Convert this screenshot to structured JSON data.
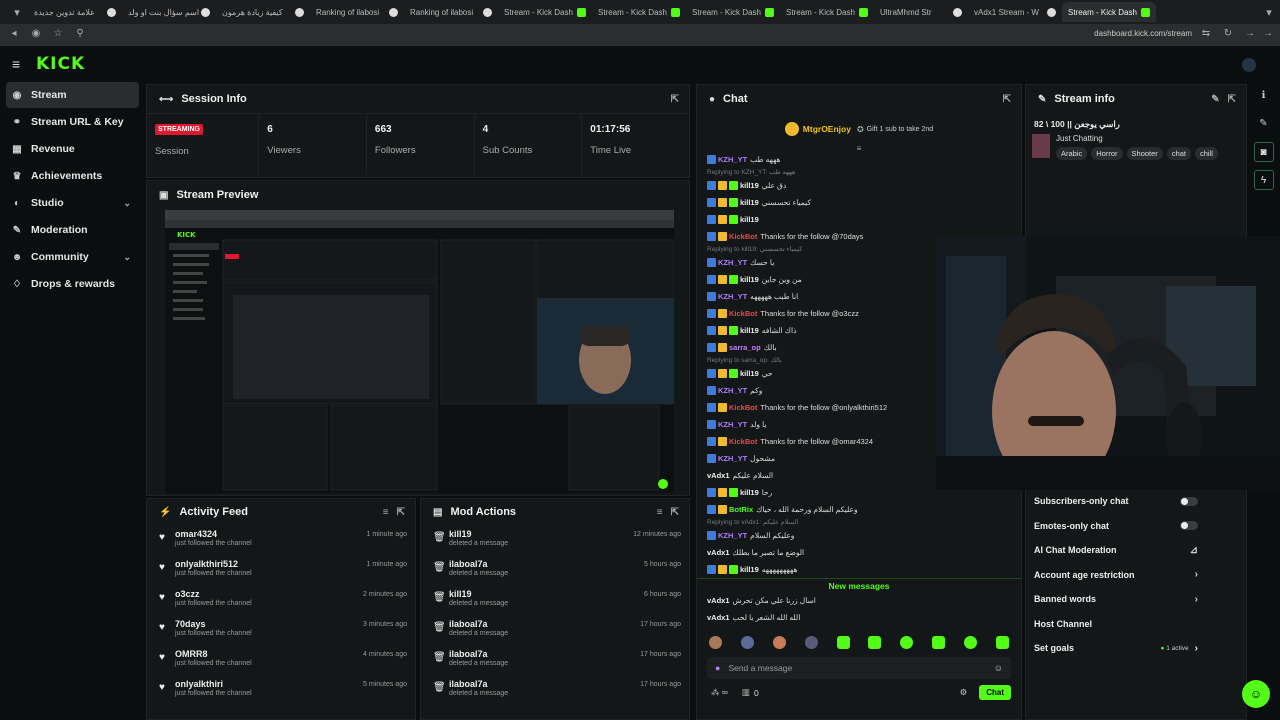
{
  "browser": {
    "tabs": [
      {
        "label": "علامة تدوين جديدة"
      },
      {
        "label": "اسم سؤال بنت او ولد"
      },
      {
        "label": "كيفية زيادة هرمون"
      },
      {
        "label": "Ranking of ilabosi"
      },
      {
        "label": "Ranking of ilabosi"
      },
      {
        "label": "Stream - Kick Dash"
      },
      {
        "label": "Stream - Kick Dash"
      },
      {
        "label": "Stream - Kick Dash"
      },
      {
        "label": "Stream - Kick Dash"
      },
      {
        "label": "UltraMhmd Str"
      },
      {
        "label": "vAdx1 Stream - W"
      },
      {
        "label": "Stream - Kick Dash"
      }
    ],
    "url": "dashboard.kick.com/stream"
  },
  "brand": {
    "logo": "KICK",
    "accent": "#53fc18"
  },
  "sidebar": {
    "items": [
      {
        "label": "Stream",
        "icon": "broadcast-icon"
      },
      {
        "label": "Stream URL & Key",
        "icon": "link-icon"
      },
      {
        "label": "Revenue",
        "icon": "revenue-icon"
      },
      {
        "label": "Achievements",
        "icon": "trophy-icon"
      },
      {
        "label": "Studio",
        "icon": "studio-icon"
      },
      {
        "label": "Moderation",
        "icon": "wrench-icon"
      },
      {
        "label": "Community",
        "icon": "community-icon"
      },
      {
        "label": "Drops & rewards",
        "icon": "gift-icon"
      }
    ]
  },
  "session": {
    "title": "Session Info",
    "badge": "STREAMING",
    "badge_label": "Session",
    "stats": [
      {
        "value": "6",
        "label": "Viewers"
      },
      {
        "value": "663",
        "label": "Followers"
      },
      {
        "value": "4",
        "label": "Sub Counts"
      },
      {
        "value": "01:17:56",
        "label": "Time Live"
      }
    ]
  },
  "preview": {
    "title": "Stream Preview"
  },
  "activity": {
    "title": "Activity Feed",
    "items": [
      {
        "name": "omar4324",
        "sub": "just followed the channel",
        "time": "1 minute ago"
      },
      {
        "name": "onlyalkthiri512",
        "sub": "just followed the channel",
        "time": "1 minute ago"
      },
      {
        "name": "o3czz",
        "sub": "just followed the channel",
        "time": "2 minutes ago"
      },
      {
        "name": "70days",
        "sub": "just followed the channel",
        "time": "3 minutes ago"
      },
      {
        "name": "OMRR8",
        "sub": "just followed the channel",
        "time": "4 minutes ago"
      },
      {
        "name": "onlyalkthiri",
        "sub": "just followed the channel",
        "time": "5 minutes ago"
      }
    ]
  },
  "mod": {
    "title": "Mod Actions",
    "items": [
      {
        "name": "kill19",
        "sub": "deleted a message",
        "time": "12 minutes ago"
      },
      {
        "name": "ilaboal7a",
        "sub": "deleted a message",
        "time": "5 hours ago"
      },
      {
        "name": "kill19",
        "sub": "deleted a message",
        "time": "6 hours ago"
      },
      {
        "name": "ilaboal7a",
        "sub": "deleted a message",
        "time": "17 hours ago"
      },
      {
        "name": "ilaboal7a",
        "sub": "deleted a message",
        "time": "17 hours ago"
      },
      {
        "name": "ilaboal7a",
        "sub": "deleted a message",
        "time": "17 hours ago"
      }
    ]
  },
  "chat": {
    "title": "Chat",
    "gifter": "MtgrOEnjoy",
    "gift_text": "Gift 1 sub to take 2nd",
    "lines": [
      {
        "reply": "",
        "user": "KZH_YT",
        "color": "#b07cff",
        "badges": 1,
        "msg": "هههه طب"
      },
      {
        "reply": "Replying to KZH_YT: هههه طب",
        "user": "kill19",
        "color": "#eeeeee",
        "badges": 3,
        "msg": "دق علي"
      },
      {
        "reply": "",
        "user": "kill19",
        "color": "#eeeeee",
        "badges": 3,
        "msg": "كيمياء تحسسني"
      },
      {
        "reply": "",
        "user": "kill19",
        "color": "#eeeeee",
        "badges": 3,
        "msg": ""
      },
      {
        "reply": "",
        "user": "KickBot",
        "color": "#e5484d",
        "badges": 2,
        "msg": "Thanks for the follow @70days"
      },
      {
        "reply": "Replying to kill19: كيمياء تحسسني",
        "user": "KZH_YT",
        "color": "#b07cff",
        "badges": 1,
        "msg": "يا حسك"
      },
      {
        "reply": "",
        "user": "kill19",
        "color": "#eeeeee",
        "badges": 3,
        "msg": "من وين جاين"
      },
      {
        "reply": "",
        "user": "KZH_YT",
        "color": "#b07cff",
        "badges": 1,
        "msg": "انا طيب هههههه"
      },
      {
        "reply": "",
        "user": "KickBot",
        "color": "#e5484d",
        "badges": 2,
        "msg": "Thanks for the follow @o3czz"
      },
      {
        "reply": "",
        "user": "kill19",
        "color": "#eeeeee",
        "badges": 3,
        "msg": "ذاك الشافه"
      },
      {
        "reply": "",
        "user": "sarra_op",
        "color": "#c77dff",
        "badges": 2,
        "msg": "بالك"
      },
      {
        "reply": "Replying to sarra_op: بالك",
        "user": "kill19",
        "color": "#eeeeee",
        "badges": 3,
        "msg": "حي"
      },
      {
        "reply": "",
        "user": "KZH_YT",
        "color": "#b07cff",
        "badges": 1,
        "msg": "وكم"
      },
      {
        "reply": "",
        "user": "KickBot",
        "color": "#e5484d",
        "badges": 2,
        "msg": "Thanks for the follow @onlyalkthiri512"
      },
      {
        "reply": "",
        "user": "KZH_YT",
        "color": "#b07cff",
        "badges": 1,
        "msg": "يا ولد"
      },
      {
        "reply": "",
        "user": "KickBot",
        "color": "#e5484d",
        "badges": 2,
        "msg": "Thanks for the follow @omar4324"
      },
      {
        "reply": "",
        "user": "KZH_YT",
        "color": "#b07cff",
        "badges": 1,
        "msg": "مشحول"
      },
      {
        "reply": "",
        "user": "vAdx1",
        "color": "#eeeeee",
        "badges": 0,
        "msg": "السلام عليكم"
      },
      {
        "reply": "",
        "user": "kill19",
        "color": "#eeeeee",
        "badges": 3,
        "msg": "رحا"
      },
      {
        "reply": "",
        "user": "BotRix",
        "color": "#53fc18",
        "badges": 2,
        "msg": "وعليكم السلام ورحمة الله ، حياك"
      },
      {
        "reply": "Replying to vAdx1: السلام عليكم",
        "user": "KZH_YT",
        "color": "#b07cff",
        "badges": 1,
        "msg": "وعليكم السلام"
      },
      {
        "reply": "",
        "user": "vAdx1",
        "color": "#eeeeee",
        "badges": 0,
        "msg": "الوضع ما تصير ما بطلك"
      },
      {
        "reply": "",
        "user": "kill19",
        "color": "#eeeeee",
        "badges": 3,
        "msg": "هههههههههه"
      }
    ],
    "new_messages": "New messages",
    "after": [
      {
        "user": "vAdx1",
        "msg": "اسال زرنا علي مكن تحرش"
      },
      {
        "user": "vAdx1",
        "msg": "الله الله الشعر يا لحب"
      }
    ],
    "input_placeholder": "Send a message",
    "count_a": "0",
    "send_label": "Chat"
  },
  "streaminfo": {
    "title": "Stream info",
    "stream_title": "راسي يوجعن || 100 \\ 82",
    "category": "Just Chatting",
    "tags": [
      "Arabic",
      "Horror",
      "Shooter",
      "chat",
      "chill"
    ],
    "settings": [
      {
        "label": "Subscribers-only chat",
        "ctrl": "toggle"
      },
      {
        "label": "Emotes-only chat",
        "ctrl": "toggle"
      },
      {
        "label": "AI Chat Moderation",
        "ctrl": "chart"
      },
      {
        "label": "Account age restriction",
        "ctrl": "chev"
      },
      {
        "label": "Banned words",
        "ctrl": "chev"
      },
      {
        "label": "Host Channel",
        "ctrl": "none"
      },
      {
        "label": "Set goals",
        "ctrl": "goals",
        "extra": "1 active"
      }
    ]
  }
}
